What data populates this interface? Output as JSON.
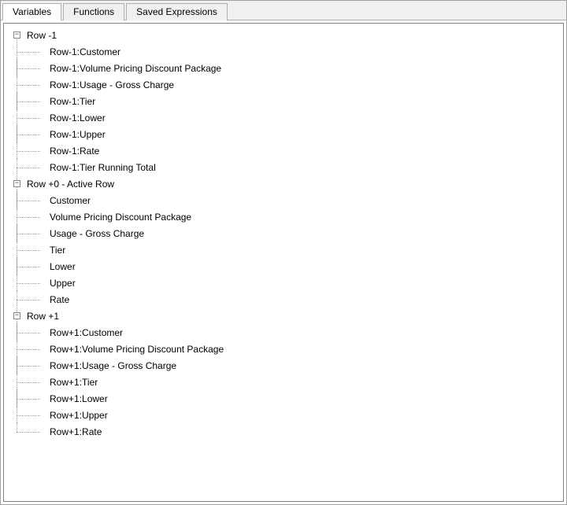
{
  "tabs": {
    "variables": "Variables",
    "functions": "Functions",
    "saved_expressions": "Saved Expressions"
  },
  "tree": {
    "groups": [
      {
        "label": "Row -1",
        "children": [
          {
            "label": "Row-1:Customer"
          },
          {
            "label": "Row-1:Volume Pricing Discount Package"
          },
          {
            "label": "Row-1:Usage - Gross Charge"
          },
          {
            "label": "Row-1:Tier"
          },
          {
            "label": "Row-1:Lower"
          },
          {
            "label": "Row-1:Upper"
          },
          {
            "label": "Row-1:Rate"
          },
          {
            "label": "Row-1:Tier Running Total"
          }
        ]
      },
      {
        "label": "Row +0 - Active Row",
        "children": [
          {
            "label": "Customer"
          },
          {
            "label": "Volume Pricing Discount Package"
          },
          {
            "label": "Usage - Gross Charge"
          },
          {
            "label": "Tier"
          },
          {
            "label": "Lower"
          },
          {
            "label": "Upper"
          },
          {
            "label": "Rate"
          }
        ]
      },
      {
        "label": "Row +1",
        "children": [
          {
            "label": "Row+1:Customer"
          },
          {
            "label": "Row+1:Volume Pricing Discount Package"
          },
          {
            "label": "Row+1:Usage - Gross Charge"
          },
          {
            "label": "Row+1:Tier"
          },
          {
            "label": "Row+1:Lower"
          },
          {
            "label": "Row+1:Upper"
          },
          {
            "label": "Row+1:Rate"
          }
        ]
      }
    ]
  },
  "icons": {
    "minus": "−"
  }
}
